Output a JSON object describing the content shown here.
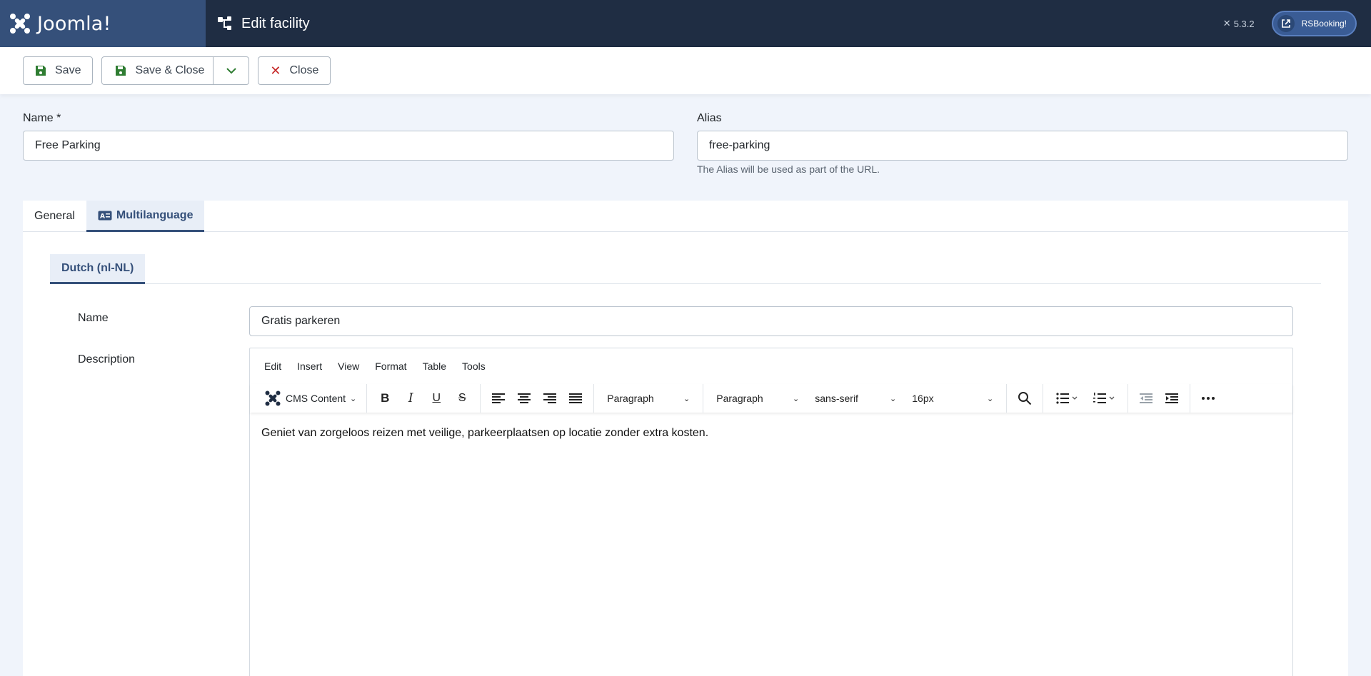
{
  "header": {
    "logo_text": "Joomla!",
    "page_title": "Edit facility",
    "version": "5.3.2",
    "rs_button": "RSBooking!"
  },
  "toolbar": {
    "save": "Save",
    "save_close": "Save & Close",
    "close": "Close"
  },
  "form": {
    "name_label": "Name *",
    "name_value": "Free Parking",
    "alias_label": "Alias",
    "alias_value": "free-parking",
    "alias_hint": "The Alias will be used as part of the URL."
  },
  "tabs": [
    {
      "label": "General"
    },
    {
      "label": "Multilanguage"
    }
  ],
  "subtabs": [
    {
      "label": "Dutch (nl-NL)"
    }
  ],
  "multilang": {
    "name_label": "Name",
    "name_value": "Gratis parkeren",
    "description_label": "Description"
  },
  "editor": {
    "menu": [
      "Edit",
      "Insert",
      "View",
      "Format",
      "Table",
      "Tools"
    ],
    "cms_content": "CMS Content",
    "block_format": "Paragraph",
    "styles": "Paragraph",
    "font_family": "sans-serif",
    "font_size": "16px",
    "content": "Geniet van zorgeloos reizen met veilige, parkeerplaatsen op locatie zonder extra kosten."
  },
  "colors": {
    "header_bg": "#1f2d43",
    "logo_bg": "#35507a",
    "accent": "#35507a"
  }
}
